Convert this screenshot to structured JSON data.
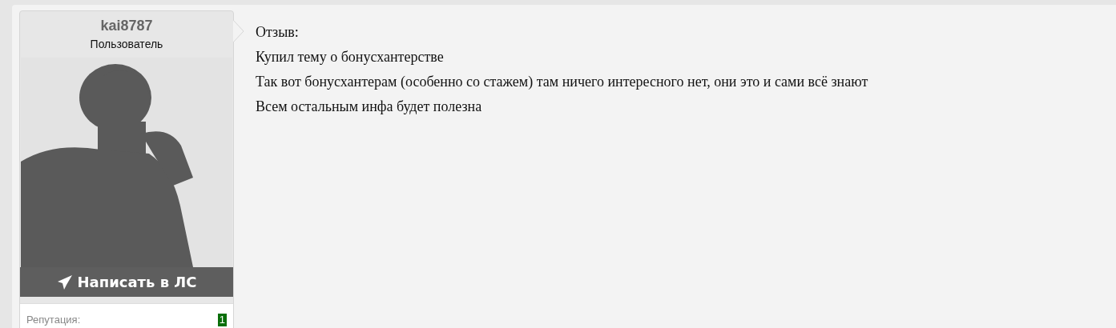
{
  "user": {
    "name": "kai8787",
    "role": "Пользователь",
    "message_button": "Написать в ЛС",
    "reputation_label": "Репутация:",
    "reputation_value": "1"
  },
  "post": {
    "lines": [
      "Отзыв:",
      "Купил тему о бонусхантерстве",
      "Так вот бонусхантерам (особенно со стажем) там ничего интересного нет, они это и сами всё знают",
      "Всем остальным инфа будет полезна"
    ]
  }
}
